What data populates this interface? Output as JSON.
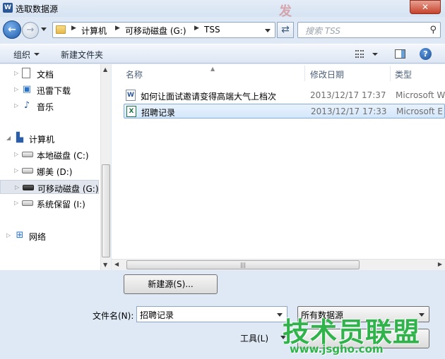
{
  "window": {
    "title": "选取数据源",
    "watermark_top": "发"
  },
  "navbar": {
    "breadcrumbs": [
      "计算机",
      "可移动磁盘 (G:)",
      "TSS"
    ],
    "search_placeholder": "搜索 TSS"
  },
  "toolbar": {
    "organize": "组织",
    "new_folder": "新建文件夹"
  },
  "sidebar": {
    "items": [
      {
        "label": "文档",
        "icon": "document-icon"
      },
      {
        "label": "迅雷下载",
        "icon": "download-folder-icon"
      },
      {
        "label": "音乐",
        "icon": "music-icon"
      },
      {
        "label": "计算机",
        "icon": "computer-icon"
      },
      {
        "label": "本地磁盘 (C:)",
        "icon": "system-drive-icon"
      },
      {
        "label": "娜美 (D:)",
        "icon": "drive-icon"
      },
      {
        "label": "可移动磁盘 (G:)",
        "icon": "usb-drive-icon",
        "selected": true
      },
      {
        "label": "系统保留 (I:)",
        "icon": "drive-icon"
      },
      {
        "label": "网络",
        "icon": "network-icon"
      }
    ]
  },
  "filelist": {
    "columns": [
      "名称",
      "修改日期",
      "类型"
    ],
    "rows": [
      {
        "name": "如何让面试邀请变得高端大气上档次",
        "date": "2013/12/17 17:37",
        "type": "Microsoft W",
        "icon": "word-doc-icon"
      },
      {
        "name": "招聘记录",
        "date": "2013/12/17 17:33",
        "type": "Microsoft E",
        "icon": "excel-doc-icon",
        "selected": true
      }
    ]
  },
  "footer": {
    "new_source_button": "新建源(S)...",
    "filename_label": "文件名(N):",
    "filename_value": "招聘记录",
    "filetype_value": "所有数据源",
    "tools_label": "工具(L)"
  },
  "watermark": {
    "text": "技术员联盟",
    "url": "www.jsgho.com"
  }
}
